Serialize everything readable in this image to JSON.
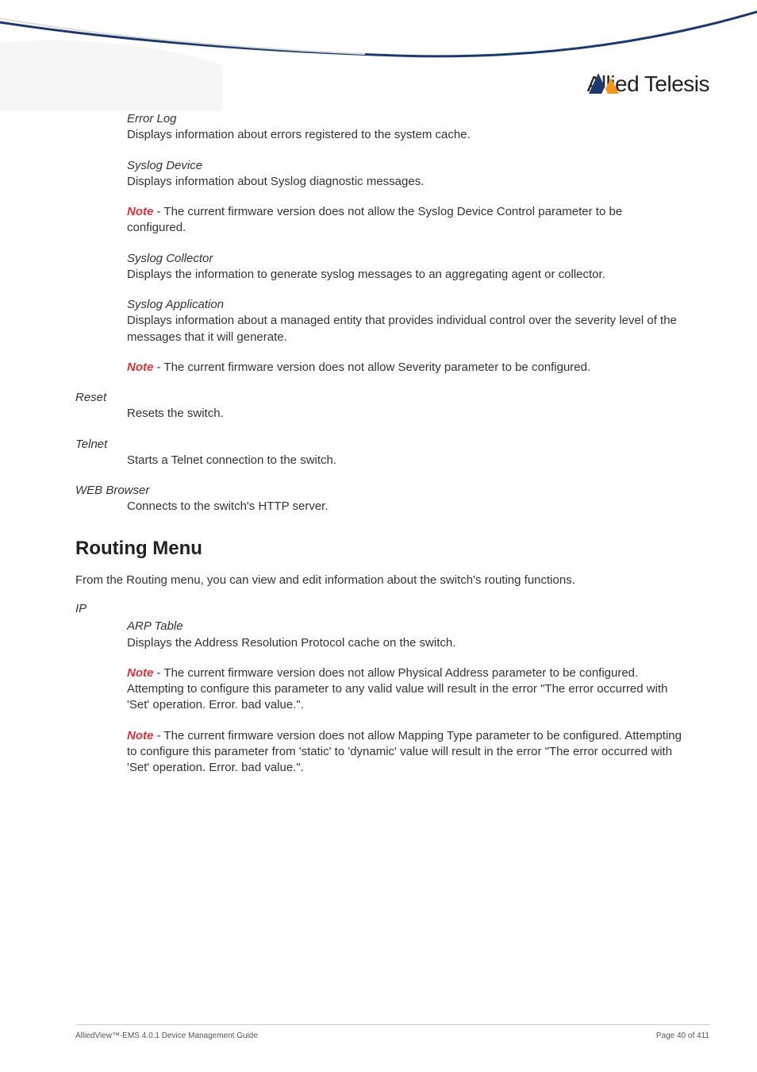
{
  "brand": "Allied Telesis",
  "sections": {
    "errorLog": {
      "title": "Error Log",
      "desc": "Displays information about errors registered to the system cache."
    },
    "syslogDevice": {
      "title": "Syslog Device",
      "desc": "Displays information about Syslog diagnostic messages."
    },
    "note1": {
      "label": "Note",
      "text": " - The current firmware version does not allow the Syslog Device Control parameter to be configured."
    },
    "syslogCollector": {
      "title": "Syslog Collector",
      "desc": "Displays the information to generate syslog messages to an aggregating agent or collector."
    },
    "syslogApplication": {
      "title": "Syslog Application",
      "desc": "Displays information about a managed entity that provides individual control over the severity level of the messages that it will generate."
    },
    "note2": {
      "label": "Note",
      "text": " - The current firmware version does not allow Severity parameter to be configured."
    },
    "reset": {
      "title": "Reset",
      "desc": "Resets the switch."
    },
    "telnet": {
      "title": "Telnet",
      "desc": "Starts a Telnet connection to the switch."
    },
    "webBrowser": {
      "title": "WEB Browser",
      "desc": "Connects to the switch's HTTP server."
    }
  },
  "routing": {
    "heading": "Routing Menu",
    "intro": "From the Routing menu, you can view and edit information about the switch's routing functions.",
    "ip": {
      "label": "IP",
      "arpTable": {
        "title": "ARP Table",
        "desc": "Displays the Address Resolution Protocol cache on the switch."
      },
      "note3": {
        "label": "Note",
        "text": " - The current firmware version does not allow Physical Address parameter to be configured. Attempting to configure this parameter to any valid value will result in the error \"The error occurred with 'Set' operation. Error. bad value.\"."
      },
      "note4": {
        "label": "Note",
        "text": " - The current firmware version does not allow Mapping Type parameter to be configured. Attempting to configure this parameter from 'static' to 'dynamic' value will result in the error \"The error occurred with 'Set' operation. Error. bad value.\"."
      }
    }
  },
  "footer": {
    "left": "AlliedView™-EMS 4.0.1 Device Management Guide",
    "right": "Page 40 of 411"
  }
}
